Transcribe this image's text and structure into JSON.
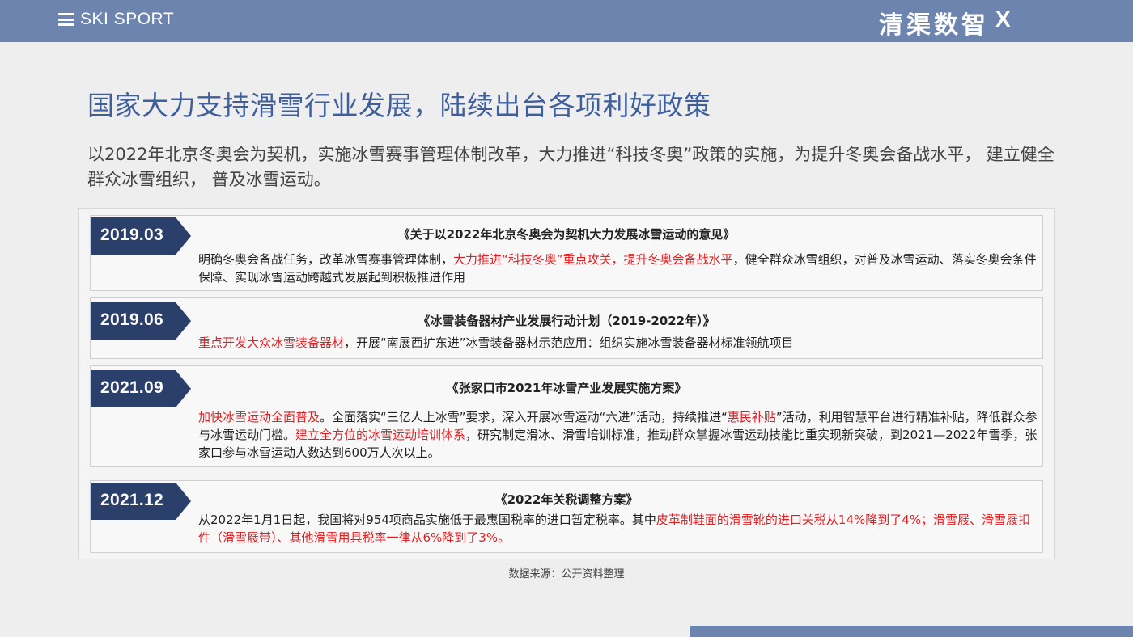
{
  "header": {
    "brand": "SKI SPORT",
    "logo_text": "清渠数智",
    "logo_x": "X"
  },
  "title": "国家大力支持滑雪行业发展，陆续出台各项利好政策",
  "subtitle": "以2022年北京冬奥会为契机，实施冰雪赛事管理体制改革，大力推进“科技冬奥”政策的实施，为提升冬奥会备战水平， 建立健全群众冰雪组织， 普及冰雪运动。",
  "colors": {
    "accent": "#6d85ae",
    "title_blue": "#3e5f9c",
    "tag_navy": "#2b3f6b",
    "highlight_red": "#e01f22"
  },
  "policies": [
    {
      "date": "2019.03",
      "title": "《关于以2022年北京冬奥会为契机大力发展冰雪运动的意见》",
      "body": [
        {
          "text": "明确冬奥会备战任务，改革冰雪赛事管理体制，",
          "red": false
        },
        {
          "text": "大力推进“科技冬奥”重点攻关，提升冬奥会备战水平",
          "red": true
        },
        {
          "text": "，健全群众冰雪组织，对普及冰雪运动、落实冬奥会条件保障、实现冰雪运动跨越式发展起到积极推进作用",
          "red": false
        }
      ]
    },
    {
      "date": "2019.06",
      "title": "《冰雪装备器材产业发展行动计划（2019-2022年）》",
      "body": [
        {
          "text": "重点开发大众冰雪装备器材",
          "red": true
        },
        {
          "text": "，开展“南展西扩东进”冰雪装备器材示范应用：组织实施冰雪装备器材标准领航项目",
          "red": false
        }
      ]
    },
    {
      "date": "2021.09",
      "title": "《张家口市2021年冰雪产业发展实施方案》",
      "body": [
        {
          "text": "加快冰雪运动全面普及",
          "red": true
        },
        {
          "text": "。全面落实“三亿人上冰雪”要求，深入开展冰雪运动“六进”活动，持续推进“",
          "red": false
        },
        {
          "text": "惠民补贴",
          "red": true
        },
        {
          "text": "”活动，利用智慧平台进行精准补贴，降低群众参与冰雪运动门槛。",
          "red": false
        },
        {
          "text": "建立全方位的冰雪运动培训体系",
          "red": true
        },
        {
          "text": "，研究制定滑冰、滑雪培训标准，推动群众掌握冰雪运动技能比重实现新突破，到2021—2022年雪季，张家口参与冰雪运动人数达到600万人次以上。",
          "red": false
        }
      ]
    },
    {
      "date": "2021.12",
      "title": "《2022年关税调整方案》",
      "body": [
        {
          "text": "从2022年1月1日起，我国将对954项商品实施低于最惠国税率的进口暂定税率。其中",
          "red": false
        },
        {
          "text": "皮革制鞋面的滑雪靴的进口关税从14%降到了4%；滑雪屐、滑雪屐扣件（滑雪屐带）、其他滑雪用具税率一律从6%降到了3%。",
          "red": true
        }
      ]
    }
  ],
  "source": "数据来源：公开资料整理"
}
